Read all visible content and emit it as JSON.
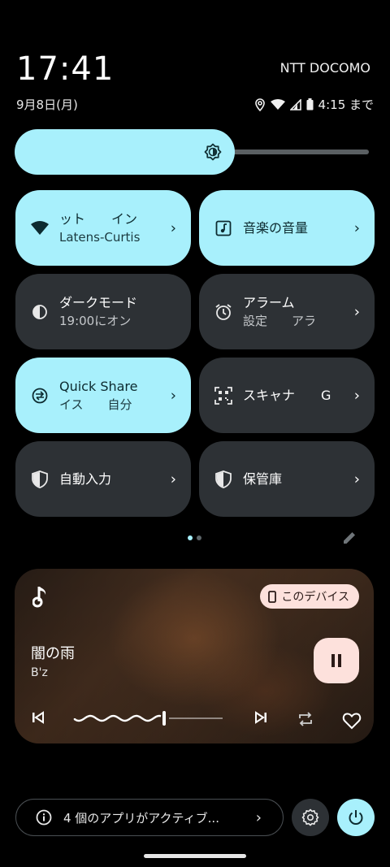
{
  "status": {
    "time": "17:41",
    "date": "9月8日(月)",
    "carrier": "NTT DOCOMO",
    "battery_text": "4:15 まで"
  },
  "brightness": {
    "level_fraction": 0.57
  },
  "tiles": [
    {
      "title": "ット　　イン",
      "subtitle": "Latens-Curtis",
      "icon": "wifi-icon",
      "active": true
    },
    {
      "title": "音楽の音量",
      "subtitle": "",
      "icon": "music-note-icon",
      "active": true
    },
    {
      "title": "ダークモード",
      "subtitle": "19:00にオン",
      "icon": "contrast-icon",
      "active": false
    },
    {
      "title": "アラーム",
      "subtitle": "設定　　アラ",
      "icon": "alarm-icon",
      "active": false
    },
    {
      "title": "Quick Share",
      "subtitle": "イス　　自分",
      "icon": "quick-share-icon",
      "active": true
    },
    {
      "title": "スキャナ　　G",
      "subtitle": "",
      "icon": "qr-scanner-icon",
      "active": false
    },
    {
      "title": "自動入力",
      "subtitle": "",
      "icon": "shield-icon",
      "active": false
    },
    {
      "title": "保管庫",
      "subtitle": "",
      "icon": "shield-icon",
      "active": false
    }
  ],
  "pager": {
    "pages": 2,
    "current": 1
  },
  "media": {
    "song": "闇の雨",
    "artist": "B'z",
    "output_device": "このデバイス",
    "progress_fraction": 0.6,
    "colors": {
      "chip": "#fde1dc"
    }
  },
  "footer": {
    "active_apps": "4 個のアプリがアクティブ..."
  },
  "colors": {
    "accent": "#a8f0fc",
    "tile_inactive": "#2d3135"
  }
}
